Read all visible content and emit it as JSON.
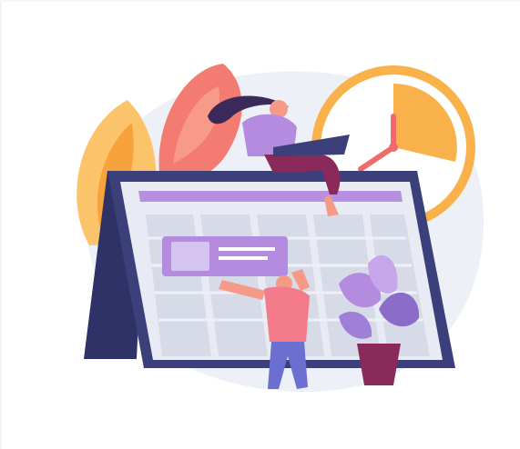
{
  "illustration": {
    "subject": "",
    "colors": {
      "background": "#ffffff",
      "blob_light": "#eef0f7",
      "leaf_orange": "#f7a23a",
      "leaf_light_orange": "#fbc46b",
      "leaf_pink": "#f37b72",
      "clock_ring": "#f9b24b",
      "clock_face": "#ffffff",
      "clock_wedge": "#f9b24b",
      "clock_hand": "#f06a6a",
      "calendar_body": "#3b3f7a",
      "calendar_sheet": "#e9ebf4",
      "calendar_grid": "#d7dbe8",
      "calendar_header": "#b68fe0",
      "note_card": "#b48bde",
      "note_card_light": "#d6c4f0",
      "woman_hair": "#3a2a5a",
      "woman_top": "#b48bde",
      "woman_pants": "#8a2a5a",
      "laptop": "#3b3f7a",
      "man_shirt": "#f37b8a",
      "man_pants": "#6b6fd0",
      "skin": "#f49a86",
      "plant_leaf": "#b48bde",
      "plant_leaf_dark": "#8b6cc8",
      "pot": "#8a2a5a"
    }
  }
}
